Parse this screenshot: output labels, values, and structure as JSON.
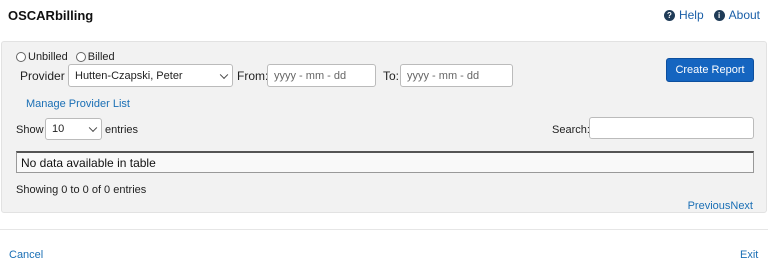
{
  "header": {
    "title": "OSCARbilling",
    "help_label": "Help",
    "about_label": "About"
  },
  "filters": {
    "radio_unbilled": "Unbilled",
    "radio_billed": "Billed",
    "provider_label": "Provider",
    "provider_value": "Hutten-Czapski, Peter",
    "from_label": "From:",
    "from_placeholder": "yyyy - mm - dd",
    "to_label": "To:",
    "to_placeholder": "yyyy - mm - dd",
    "create_report": "Create Report",
    "manage_provider_list": "Manage Provider List"
  },
  "table": {
    "show_label": "Show",
    "entries_value": "10",
    "entries_label": "entries",
    "search_label": "Search:",
    "empty_message": "No data available in table",
    "info": "Showing 0 to 0 of 0 entries",
    "previous": "Previous",
    "next": "Next"
  },
  "footer": {
    "cancel": "Cancel",
    "exit": "Exit"
  }
}
